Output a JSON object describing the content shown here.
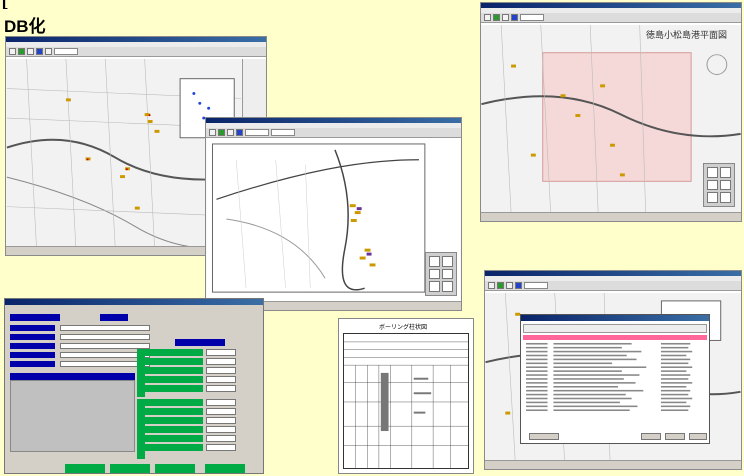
{
  "header": {
    "line1": "[",
    "line2": "DB化"
  },
  "win3": {
    "map_title": "徳島小松島港平面図"
  },
  "doc": {
    "title": "ボーリング柱状図"
  },
  "colors": {
    "background": "#ffffcc",
    "accent_blue": "#0000aa",
    "accent_green": "#00aa44",
    "highlight_pink": "#ff6699"
  }
}
